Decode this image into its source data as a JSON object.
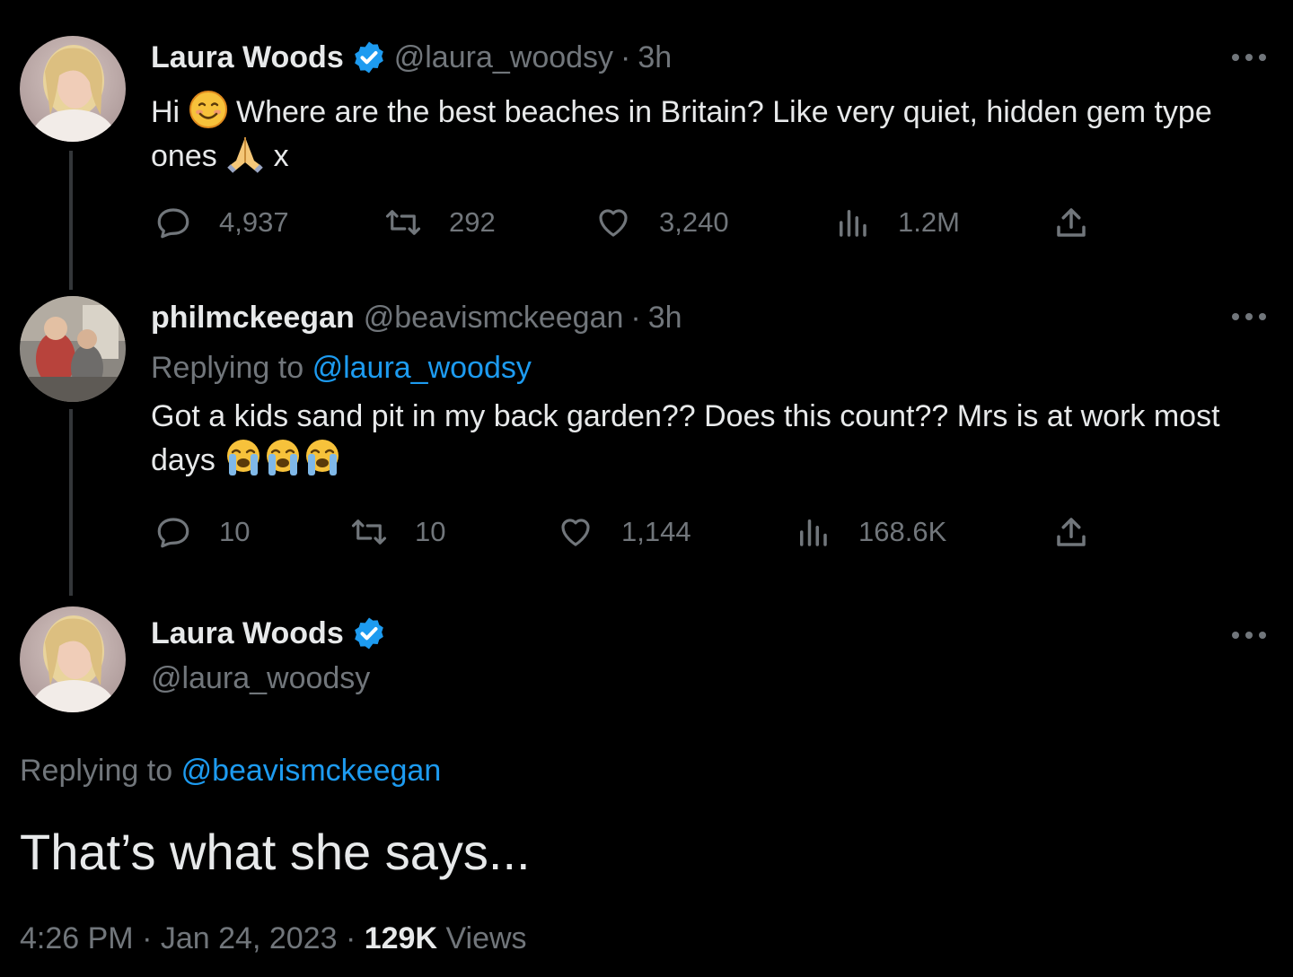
{
  "colors": {
    "background": "#000000",
    "text_primary": "#e7e9ea",
    "text_secondary": "#71767b",
    "accent": "#1d9bf0",
    "thread_line": "#333639"
  },
  "tweet1": {
    "display_name": "Laura Woods",
    "verified_icon": "verified-badge-icon",
    "handle": "@laura_woodsy",
    "separator": "·",
    "time": "3h",
    "text_part1": "Hi",
    "emoji1": "smiling-face-emoji",
    "text_part2": "Where are the best beaches in Britain? Like very quiet, hidden gem type ones",
    "emoji2": "folded-hands-emoji",
    "text_part3": "x",
    "metrics": {
      "replies": "4,937",
      "retweets": "292",
      "likes": "3,240",
      "views": "1.2M"
    }
  },
  "tweet2": {
    "display_name": "philmckeegan",
    "handle": "@beavismckeegan",
    "separator": "·",
    "time": "3h",
    "replying_label": "Replying to",
    "replying_handle": "@laura_woodsy",
    "text": "Got a kids sand pit in my back garden?? Does this count?? Mrs is at work most days",
    "emoji": "loudly-crying-face-emoji",
    "metrics": {
      "replies": "10",
      "retweets": "10",
      "likes": "1,144",
      "views": "168.6K"
    }
  },
  "tweet3": {
    "display_name": "Laura Woods",
    "handle": "@laura_woodsy",
    "replying_label": "Replying to",
    "replying_handle": "@beavismckeegan",
    "text": "That’s what she says...",
    "time": "4:26 PM",
    "separator": "·",
    "date": "Jan 24, 2023",
    "views_count": "129K",
    "views_label": "Views"
  },
  "icons": {
    "more": "more-horizontal-icon",
    "reply": "reply-bubble-icon",
    "retweet": "retweet-icon",
    "like": "heart-icon",
    "views": "views-bar-chart-icon",
    "share": "share-upload-icon"
  }
}
